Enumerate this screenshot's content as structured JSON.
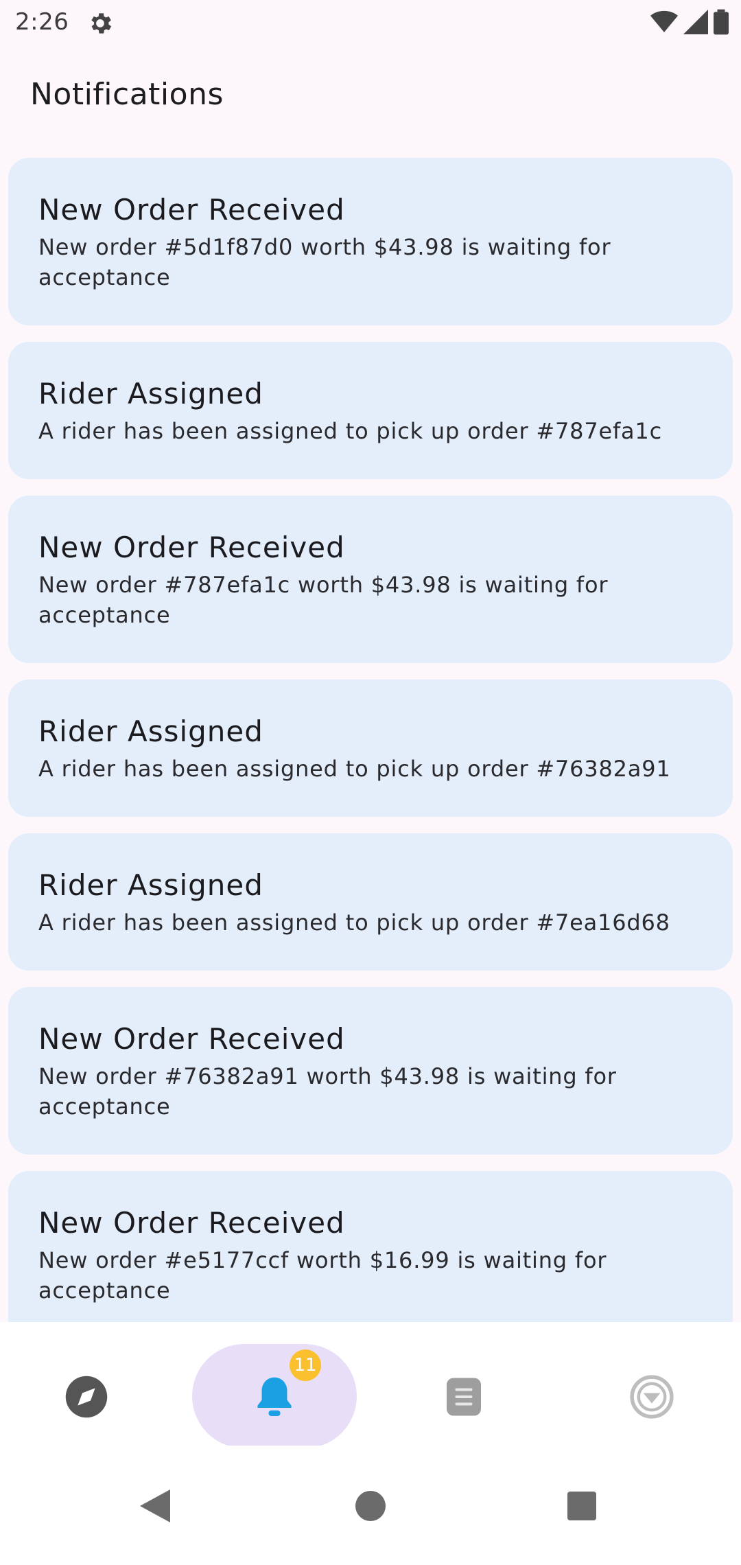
{
  "status_bar": {
    "time": "2:26"
  },
  "header": {
    "title": "Notifications"
  },
  "notifications": [
    {
      "title": "New Order Received",
      "body": "New order #5d1f87d0 worth $43.98 is waiting for acceptance"
    },
    {
      "title": "Rider Assigned",
      "body": "A rider has been assigned to pick up order #787efa1c"
    },
    {
      "title": "New Order Received",
      "body": "New order #787efa1c worth $43.98 is waiting for acceptance"
    },
    {
      "title": "Rider Assigned",
      "body": "A rider has been assigned to pick up order #76382a91"
    },
    {
      "title": "Rider Assigned",
      "body": "A rider has been assigned to pick up order #7ea16d68"
    },
    {
      "title": "New Order Received",
      "body": "New order #76382a91 worth $43.98 is waiting for acceptance"
    },
    {
      "title": "New Order Received",
      "body": "New order #e5177ccf worth $16.99 is waiting for acceptance"
    }
  ],
  "bottom_nav": {
    "items": [
      {
        "icon": "compass-icon",
        "selected": false
      },
      {
        "icon": "bell-icon",
        "selected": true,
        "badge": "11"
      },
      {
        "icon": "document-icon",
        "selected": false
      },
      {
        "icon": "chevron-down-circle-icon",
        "selected": false
      }
    ]
  },
  "colors": {
    "background": "#fdf7fc",
    "card": "#e3eefa",
    "nav_pill": "#e8def8",
    "bell": "#1aa1e3",
    "badge": "#fbc02d"
  }
}
